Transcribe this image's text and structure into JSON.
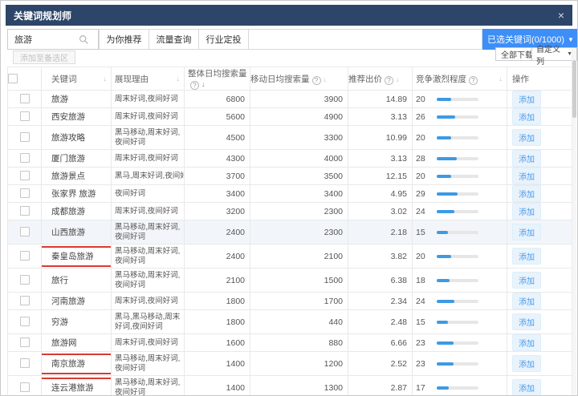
{
  "window": {
    "title": "关键词规划师",
    "close_icon": "×"
  },
  "toolbar": {
    "search": {
      "value": "旅游"
    },
    "tabs": [
      {
        "label": "为你推荐"
      },
      {
        "label": "流量查询"
      },
      {
        "label": "行业定投"
      }
    ],
    "selected_keywords_button": "已选关键词(0/1000)",
    "add_to_candidates": "添加至备选区",
    "download_all": "全部下载",
    "customize_columns": "自定义列"
  },
  "table": {
    "columns": [
      "关键词",
      "展现理由",
      "整体日均搜索量",
      "移动日均搜索量",
      "推荐出价",
      "竞争激烈程度",
      "操作"
    ],
    "action_label": "添加",
    "rows": [
      {
        "keyword": "旅游",
        "reason": "周末好词,夜间好词",
        "overall": "6800",
        "mobile": "3900",
        "bid": "14.89",
        "competition": 20
      },
      {
        "keyword": "西安旅游",
        "reason": "周末好词,夜间好词",
        "overall": "5600",
        "mobile": "4900",
        "bid": "3.13",
        "competition": 26
      },
      {
        "keyword": "旅游攻略",
        "reason": "黑马移动,周末好词,夜间好词",
        "overall": "4500",
        "mobile": "3300",
        "bid": "10.99",
        "competition": 20
      },
      {
        "keyword": "厦门旅游",
        "reason": "周末好词,夜间好词",
        "overall": "4300",
        "mobile": "4000",
        "bid": "3.13",
        "competition": 28
      },
      {
        "keyword": "旅游景点",
        "reason": "黑马,周末好词,夜间好词",
        "overall": "3700",
        "mobile": "3500",
        "bid": "12.15",
        "competition": 20
      },
      {
        "keyword": "张家界 旅游",
        "reason": "夜间好词",
        "overall": "3400",
        "mobile": "3400",
        "bid": "4.95",
        "competition": 29
      },
      {
        "keyword": "成都旅游",
        "reason": "周末好词,夜间好词",
        "overall": "3200",
        "mobile": "2300",
        "bid": "3.02",
        "competition": 24
      },
      {
        "keyword": "山西旅游",
        "reason": "黑马移动,周末好词,夜间好词",
        "overall": "2400",
        "mobile": "2300",
        "bid": "2.18",
        "competition": 15
      },
      {
        "keyword": "秦皇岛旅游",
        "reason": "黑马移动,周末好词,夜间好词",
        "overall": "2400",
        "mobile": "2100",
        "bid": "3.82",
        "competition": 20
      },
      {
        "keyword": "旅行",
        "reason": "黑马移动,周末好词,夜间好词",
        "overall": "2100",
        "mobile": "1500",
        "bid": "6.38",
        "competition": 18
      },
      {
        "keyword": "河南旅游",
        "reason": "周末好词,夜间好词",
        "overall": "1800",
        "mobile": "1700",
        "bid": "2.34",
        "competition": 24
      },
      {
        "keyword": "穷游",
        "reason": "黑马,黑马移动,周末好词,夜间好词",
        "overall": "1800",
        "mobile": "440",
        "bid": "2.48",
        "competition": 15
      },
      {
        "keyword": "旅游网",
        "reason": "周末好词,夜间好词",
        "overall": "1600",
        "mobile": "880",
        "bid": "6.66",
        "competition": 23
      },
      {
        "keyword": "南京旅游",
        "reason": "黑马移动,周末好词,夜间好词",
        "overall": "1400",
        "mobile": "1200",
        "bid": "2.52",
        "competition": 23
      },
      {
        "keyword": "连云港旅游",
        "reason": "黑马移动,周末好词,夜间好词",
        "overall": "1400",
        "mobile": "1300",
        "bid": "2.87",
        "competition": 17
      }
    ]
  },
  "colors": {
    "titlebar_bg": "#2d4568",
    "accent_blue": "#3e8ef7",
    "bar_fill": "#3d9ae3",
    "annotation_red": "#d93a32",
    "add_button_bg": "#e9f3fc"
  }
}
